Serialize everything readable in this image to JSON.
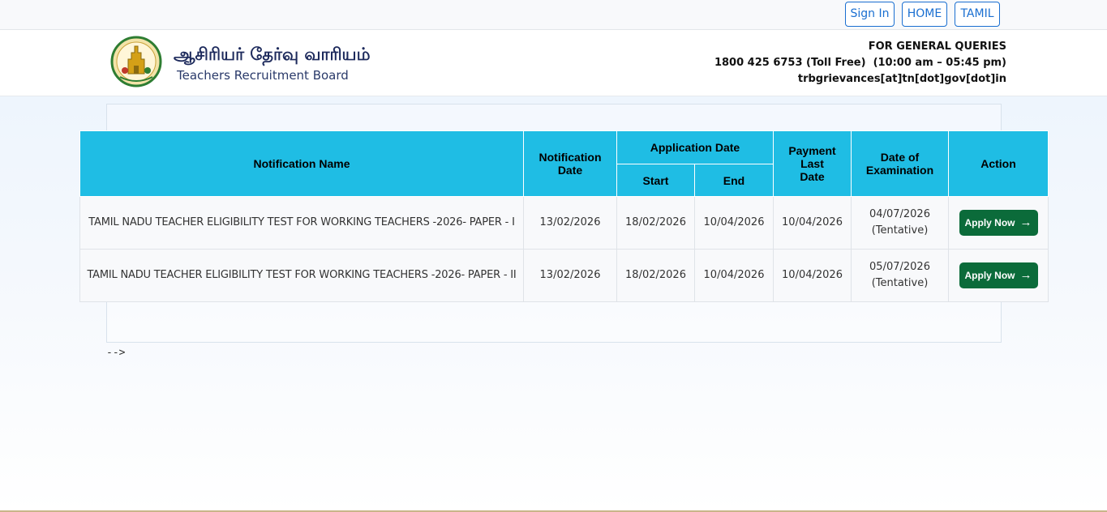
{
  "topbar": {
    "sign_in": "Sign In",
    "home": "HOME",
    "tamil": "TAMIL"
  },
  "header": {
    "logo_tamil": "ஆசிரியர் தேர்வு வாரியம்",
    "logo_english": "Teachers Recruitment Board",
    "queries_title": "FOR GENERAL QUERIES",
    "queries_phone": "1800 425 6753 (Toll Free)  (10:00 am – 05:45 pm)",
    "queries_email": "trbgrievances[at]tn[dot]gov[dot]in"
  },
  "table": {
    "headers": {
      "name": "Notification Name",
      "notification_date_1": "Notification",
      "notification_date_2": "Date",
      "application_date": "Application Date",
      "start": "Start",
      "end": "End",
      "payment_1": "Payment",
      "payment_2": "Last",
      "payment_3": "Date",
      "exam_1": "Date of",
      "exam_2": "Examination",
      "action": "Action"
    },
    "rows": [
      {
        "name": "TAMIL NADU TEACHER ELIGIBILITY TEST FOR WORKING TEACHERS -2026- PAPER - I",
        "notification_date": "13/02/2026",
        "start": "18/02/2026",
        "end": "10/04/2026",
        "payment_last": "10/04/2026",
        "exam_date": "04/07/2026",
        "exam_note": "(Tentative)",
        "action": "Apply Now"
      },
      {
        "name": "TAMIL NADU TEACHER ELIGIBILITY TEST FOR WORKING TEACHERS -2026- PAPER - II",
        "notification_date": "13/02/2026",
        "start": "18/02/2026",
        "end": "10/04/2026",
        "payment_last": "10/04/2026",
        "exam_date": "05/07/2026",
        "exam_note": "(Tentative)",
        "action": "Apply Now"
      }
    ]
  },
  "stray_text": "-->",
  "icons": {
    "apply_arrow": "arrow-right-icon",
    "emblem": "tn-emblem-icon"
  },
  "colors": {
    "header_bg": "#1fbde4",
    "apply_button": "#0b6b3a",
    "link_blue": "#1a6fd1"
  }
}
